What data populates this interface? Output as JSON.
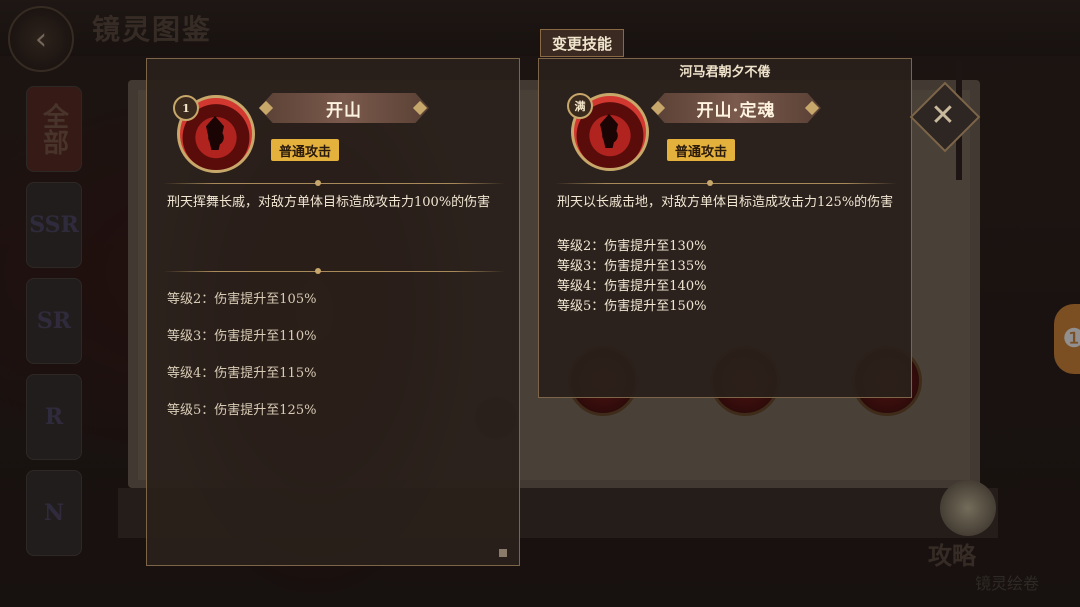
{
  "header": {
    "title": "镜灵图鉴",
    "back_icon": "back-arrow-icon"
  },
  "sidebar": {
    "tabs": [
      {
        "label": "全部",
        "active": true
      },
      {
        "label": "SSR"
      },
      {
        "label": "SR"
      },
      {
        "label": "R"
      },
      {
        "label": "N"
      }
    ]
  },
  "guide": {
    "label": "攻略",
    "sublabel": "镜灵绘卷"
  },
  "popup": {
    "title": "变更技能",
    "current_skill": {
      "level": "1",
      "name": "开山",
      "tag": "普通攻击",
      "description": "刑天挥舞长戚，对敌方单体目标造成攻击力100%的伤害",
      "levels": [
        "等级2：伤害提升至105%",
        "等级3：伤害提升至110%",
        "等级4：伤害提升至115%",
        "等级5：伤害提升至125%"
      ]
    },
    "new_skill": {
      "source": "河马君朝夕不倦",
      "level": "满",
      "name": "开山·定魂",
      "tag": "普通攻击",
      "description": "刑天以长戚击地，对敌方单体目标造成攻击力125%的伤害",
      "levels": [
        "等级2：伤害提升至130%",
        "等级3：伤害提升至135%",
        "等级4：伤害提升至140%",
        "等级5：伤害提升至150%"
      ]
    }
  },
  "colors": {
    "tag_bg": "#e4b13c",
    "panel_border": "#7c6548",
    "ribbon": "#7a5a4c"
  }
}
